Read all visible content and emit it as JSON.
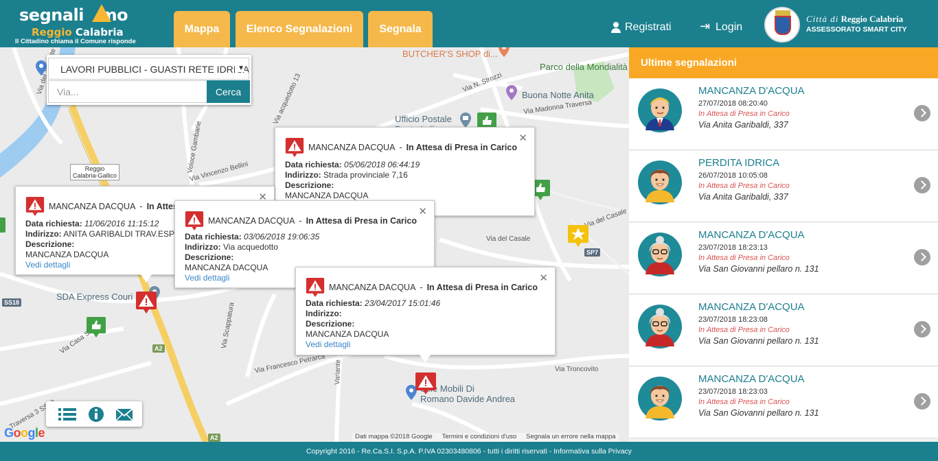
{
  "brand": {
    "name_part1": "segnali",
    "name_part2": "mo",
    "city": "Reggio",
    "city2": "Calabria",
    "tagline": "Il Cittadino chiama il Comune risponde"
  },
  "nav": {
    "tabs": [
      {
        "label": "Mappa"
      },
      {
        "label": "Elenco Segnalazioni"
      },
      {
        "label": "Segnala"
      }
    ],
    "register": "Registrati",
    "login": "Login"
  },
  "comune": {
    "line1_italic": "Città di",
    "line1_bold": "Reggio Calabria",
    "line2": "ASSESSORATO SMART CITY"
  },
  "filter": {
    "category": "LAVORI PUBBLICI - GUASTI RETE IDRICA",
    "placeholder": "Via...",
    "search_label": "Cerca"
  },
  "map_labels": {
    "shop": "BUTCHER'S SHOP di...",
    "park": "Parco della Mondialità",
    "hotel": "Buona Notte Anita",
    "post": "Ufficio Postale Poste Italiane",
    "courier": "SDA Express Couri",
    "furniture1": "Stile Mobili Di",
    "furniture2": "Romano Davide Andrea",
    "station1": "Reggio",
    "station2": "Calabria-Gallico",
    "via_torrente": "Via del Torrente",
    "via_strozzi": "Via N. Strozzi",
    "via_madonna": "Via Madonna Traversa",
    "via_acquedotto": "Via acquedotto 13",
    "via_bellini": "Via Vincenzo Bellini",
    "veloce": "Veloce Gambarie",
    "via_casale": "Via del Casale",
    "via_casale2": "Via del Casale",
    "via_petrarca": "Via Francesco Petrarca",
    "via_troncovito": "Via Troncovito",
    "via_casa_savoia": "Via Casa Savoia",
    "via_scappatura": "Via Scappatura",
    "variante": "Variante",
    "traversa": "Traversa 3 SS18",
    "sp7": "SP7",
    "ss18": "SS18",
    "a2": "A2",
    "a2b": "A2",
    "google": "Google",
    "attrib_data": "Dati mappa ©2018 Google",
    "attrib_terms": "Termini e condizioni d'uso",
    "attrib_report": "Segnala un errore nella mappa"
  },
  "popups": [
    {
      "title": "MANCANZA DACQUA",
      "status": "In Attesa di Presa in Carico",
      "date_label": "Data richiesta:",
      "date": "05/06/2018 06:44:19",
      "addr_label": "Indirizzo:",
      "addr": "Strada provinciale 7,16",
      "desc_label": "Descrizione:",
      "desc": "MANCANZA DACQUA",
      "details": ""
    },
    {
      "title": "MANCANZA DACQUA",
      "status": "In Attesa",
      "date_label": "Data richiesta:",
      "date": "11/06/2016 11:15:12",
      "addr_label": "Indirizzo:",
      "addr": "ANITA GARIBALDI TRAV.ESP",
      "desc_label": "Descrizione:",
      "desc": "MANCANZA DACQUA",
      "details": "Vedi dettagli"
    },
    {
      "title": "MANCANZA DACQUA",
      "status": "In Attesa di Presa in Carico",
      "date_label": "Data richiesta:",
      "date": "03/06/2018 19:06:35",
      "addr_label": "Indirizzo:",
      "addr": "Via acquedotto",
      "desc_label": "Descrizione:",
      "desc": "MANCANZA DACQUA",
      "details": "Vedi dettagli"
    },
    {
      "title": "MANCANZA DACQUA",
      "status": "In Attesa di Presa in Carico",
      "date_label": "Data richiesta:",
      "date": "23/04/2017 15:01:46",
      "addr_label": "Indirizzo:",
      "addr": "",
      "desc_label": "Descrizione:",
      "desc": "MANCANZA DACQUA",
      "details": "Vedi dettagli"
    }
  ],
  "side": {
    "heading": "Ultime segnalazioni",
    "reports": [
      {
        "title": "MANCANZA D'ACQUA",
        "date": "27/07/2018 08:20:40",
        "status": "In Attesa di Presa in Carico",
        "address": "Via Anita Garibaldi, 337",
        "avatar": "man-blond"
      },
      {
        "title": "PERDITA IDRICA",
        "date": "26/07/2018 10:05:08",
        "status": "In Attesa di Presa in Carico",
        "address": "Via Anita Garibaldi, 337",
        "avatar": "man-brown"
      },
      {
        "title": "MANCANZA D'ACQUA",
        "date": "23/07/2018 18:23:13",
        "status": "In Attesa di Presa in Carico",
        "address": "Via San Giovanni pellaro n. 131",
        "avatar": "old-woman"
      },
      {
        "title": "MANCANZA D'ACQUA",
        "date": "23/07/2018 18:23:08",
        "status": "In Attesa di Presa in Carico",
        "address": "Via San Giovanni pellaro n. 131",
        "avatar": "old-woman"
      },
      {
        "title": "MANCANZA D'ACQUA",
        "date": "23/07/2018 18:23:03",
        "status": "In Attesa di Presa in Carico",
        "address": "Via San Giovanni pellaro n. 131",
        "avatar": "man-brown"
      }
    ]
  },
  "footer": "Copyright 2016 - Re.Ca.S.I. S.p.A. P.IVA 02303480806 - tutti i diritti riservati - Informativa sulla Privacy",
  "colors": {
    "primary": "#1b7f8e",
    "accent": "#f9a825",
    "tab": "#f5b84a",
    "status": "#d9534f",
    "alert_marker": "#d32f2f",
    "ok_marker": "#43a047"
  }
}
